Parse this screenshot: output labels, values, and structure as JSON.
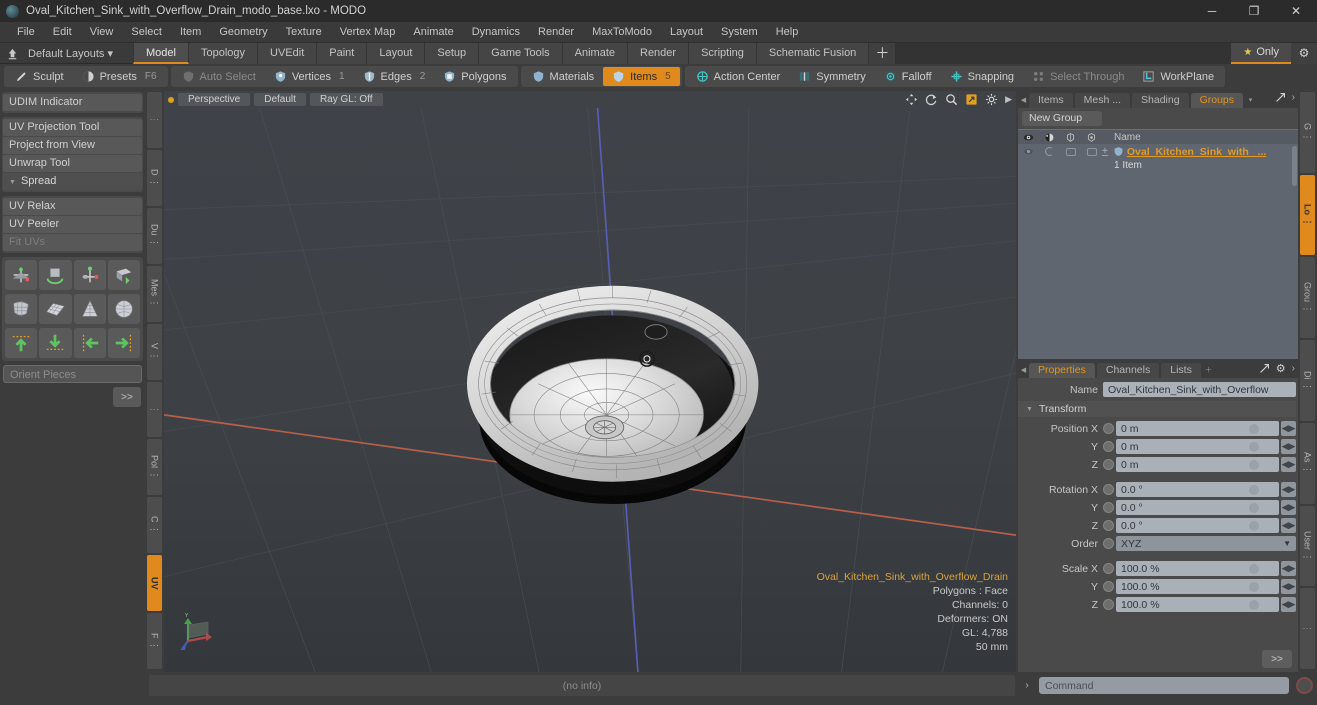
{
  "titlebar": {
    "title": "Oval_Kitchen_Sink_with_Overflow_Drain_modo_base.lxo - MODO",
    "minimize": "─",
    "maximize": "❐",
    "close": "✕"
  },
  "menubar": {
    "items": [
      "File",
      "Edit",
      "View",
      "Select",
      "Item",
      "Geometry",
      "Texture",
      "Vertex Map",
      "Animate",
      "Dynamics",
      "Render",
      "MaxToModo",
      "Layout",
      "System",
      "Help"
    ]
  },
  "layoutbar": {
    "default_layouts": "Default Layouts ▾",
    "tabs": [
      {
        "label": "Model",
        "active": true
      },
      {
        "label": "Topology",
        "active": false
      },
      {
        "label": "UVEdit",
        "active": false
      },
      {
        "label": "Paint",
        "active": false
      },
      {
        "label": "Layout",
        "active": false
      },
      {
        "label": "Setup",
        "active": false
      },
      {
        "label": "Game Tools",
        "active": false
      },
      {
        "label": "Animate",
        "active": false
      },
      {
        "label": "Render",
        "active": false
      },
      {
        "label": "Scripting",
        "active": false
      },
      {
        "label": "Schematic Fusion",
        "active": false
      }
    ],
    "plus": "＋",
    "only_label": "Only",
    "star_icon": "★",
    "gear_icon": "⚙"
  },
  "modebar": {
    "group1": [
      {
        "label": "Sculpt",
        "icon": "brush-icon",
        "state": "normal",
        "badge": ""
      },
      {
        "label": "Presets",
        "icon": "presets-icon",
        "state": "normal",
        "badge": "F6"
      }
    ],
    "group2": [
      {
        "label": "Auto Select",
        "icon": "shield-icon",
        "state": "dim",
        "badge": ""
      },
      {
        "label": "Vertices",
        "icon": "vertices-icon",
        "state": "normal",
        "badge": "1"
      },
      {
        "label": "Edges",
        "icon": "edges-icon",
        "state": "normal",
        "badge": "2"
      },
      {
        "label": "Polygons",
        "icon": "polygons-icon",
        "state": "normal",
        "badge": ""
      }
    ],
    "group3": [
      {
        "label": "Materials",
        "icon": "materials-icon",
        "state": "normal",
        "badge": ""
      },
      {
        "label": "Items",
        "icon": "items-icon",
        "state": "selected",
        "badge": "5"
      }
    ],
    "group4": [
      {
        "label": "Action Center",
        "icon": "action-center-icon",
        "state": "normal",
        "badge": ""
      },
      {
        "label": "Symmetry",
        "icon": "symmetry-icon",
        "state": "normal",
        "badge": ""
      },
      {
        "label": "Falloff",
        "icon": "falloff-icon",
        "state": "normal",
        "badge": ""
      },
      {
        "label": "Snapping",
        "icon": "snapping-icon",
        "state": "normal",
        "badge": ""
      },
      {
        "label": "Select Through",
        "icon": "select-through-icon",
        "state": "dim",
        "badge": ""
      },
      {
        "label": "WorkPlane",
        "icon": "workplane-icon",
        "state": "normal",
        "badge": ""
      }
    ]
  },
  "leftpanel": {
    "group_a": [
      {
        "label": "UDIM Indicator",
        "state": "normal"
      }
    ],
    "group_b": [
      {
        "label": "UV Projection Tool",
        "state": "normal"
      },
      {
        "label": "Project from View",
        "state": "normal"
      },
      {
        "label": "Unwrap Tool",
        "state": "normal"
      }
    ],
    "spread_header": "Spread",
    "group_c": [
      {
        "label": "UV Relax",
        "state": "normal"
      },
      {
        "label": "UV Peeler",
        "state": "normal"
      },
      {
        "label": "Fit UVs",
        "state": "dim"
      }
    ],
    "icon_rows": [
      [
        "uv-move-icon",
        "uv-rotate-icon",
        "uv-scale-icon",
        "uv-flip-icon"
      ],
      [
        "uv-fit-icon",
        "uv-grid-icon",
        "uv-cone-icon",
        "uv-sphere-icon"
      ],
      [
        "align-up-icon",
        "align-down-icon",
        "align-left-icon",
        "align-right-icon"
      ]
    ],
    "orient_pieces_placeholder": "Orient Pieces",
    "more_label": ">>",
    "vtabs": [
      "⋮",
      "D ⋮",
      "Du ⋮",
      "Mes ⋮",
      "V ⋮",
      "⋮",
      "Pol ⋮",
      "C ⋮",
      "UV",
      "F ⋮"
    ],
    "vtab_active_index": 8
  },
  "viewport": {
    "view_mode": "Perspective",
    "shading": "Default",
    "raygl": "Ray GL: Off",
    "tools": [
      "pan-icon",
      "rotate-icon",
      "zoom-icon",
      "fit-icon",
      "viewport-settings-icon",
      "chevron-right-icon"
    ],
    "info": {
      "name": "Oval_Kitchen_Sink_with_Overflow_Drain",
      "polygons": "Polygons : Face",
      "channels": "Channels: 0",
      "deformers": "Deformers: ON",
      "gl": "GL: 4,788",
      "scale": "50 mm"
    },
    "gizmo_axes": [
      "Y",
      "X",
      "Z"
    ]
  },
  "groups_panel": {
    "tabs": [
      {
        "label": "Items",
        "active": false
      },
      {
        "label": "Mesh ...",
        "active": false
      },
      {
        "label": "Shading",
        "active": false
      },
      {
        "label": "Groups",
        "active": true
      }
    ],
    "dropdown_icon": "▾",
    "expand_icon": "expand-icon",
    "chevron_icon": "›",
    "new_group_button": "New Group",
    "column_icons": [
      "eye-icon",
      "shade-icon",
      "wire-icon",
      "lock-icon"
    ],
    "name_column": "Name",
    "row": {
      "name": "Oval_Kitchen_Sink_with_ ...",
      "subtitle": "1 Item",
      "expand": "+"
    }
  },
  "properties_panel": {
    "tabs": [
      {
        "label": "Properties",
        "active": true
      },
      {
        "label": "Channels",
        "active": false
      },
      {
        "label": "Lists",
        "active": false
      }
    ],
    "plus": "＋",
    "expand_icon": "expand-icon",
    "gear_icon": "⚙",
    "chevron_icon": "›",
    "name_label": "Name",
    "name_value": "Oval_Kitchen_Sink_with_Overflow",
    "transform_header": "Transform",
    "fields": [
      {
        "label": "Position X",
        "value": "0 m",
        "type": "num"
      },
      {
        "label": "Y",
        "value": "0 m",
        "type": "num"
      },
      {
        "label": "Z",
        "value": "0 m",
        "type": "num"
      },
      {
        "label": "Rotation X",
        "value": "0.0 °",
        "type": "num"
      },
      {
        "label": "Y",
        "value": "0.0 °",
        "type": "num"
      },
      {
        "label": "Z",
        "value": "0.0 °",
        "type": "num"
      },
      {
        "label": "Order",
        "value": "XYZ",
        "type": "select"
      },
      {
        "label": "Scale X",
        "value": "100.0 %",
        "type": "num"
      },
      {
        "label": "Y",
        "value": "100.0 %",
        "type": "num"
      },
      {
        "label": "Z",
        "value": "100.0 %",
        "type": "num"
      }
    ],
    "more_label": ">>",
    "vtabs": [
      "G ⋮",
      "Lo ⋮",
      "Grou ⋮",
      "Di ⋮",
      "As ⋮",
      "User ⋮",
      "⋮"
    ],
    "vtab_active_index": 1
  },
  "statusbar": {
    "info": "(no info)",
    "arrow": "›",
    "command_placeholder": "Command",
    "record_icon": "record-icon"
  },
  "colors": {
    "accent": "#e08a1e",
    "tree_name": "#e09a28",
    "viewport_bg": "#3e4247",
    "panel_bg": "#4a4a4a",
    "axis_x": "#b05a4a",
    "axis_z": "#4a5ab0"
  }
}
